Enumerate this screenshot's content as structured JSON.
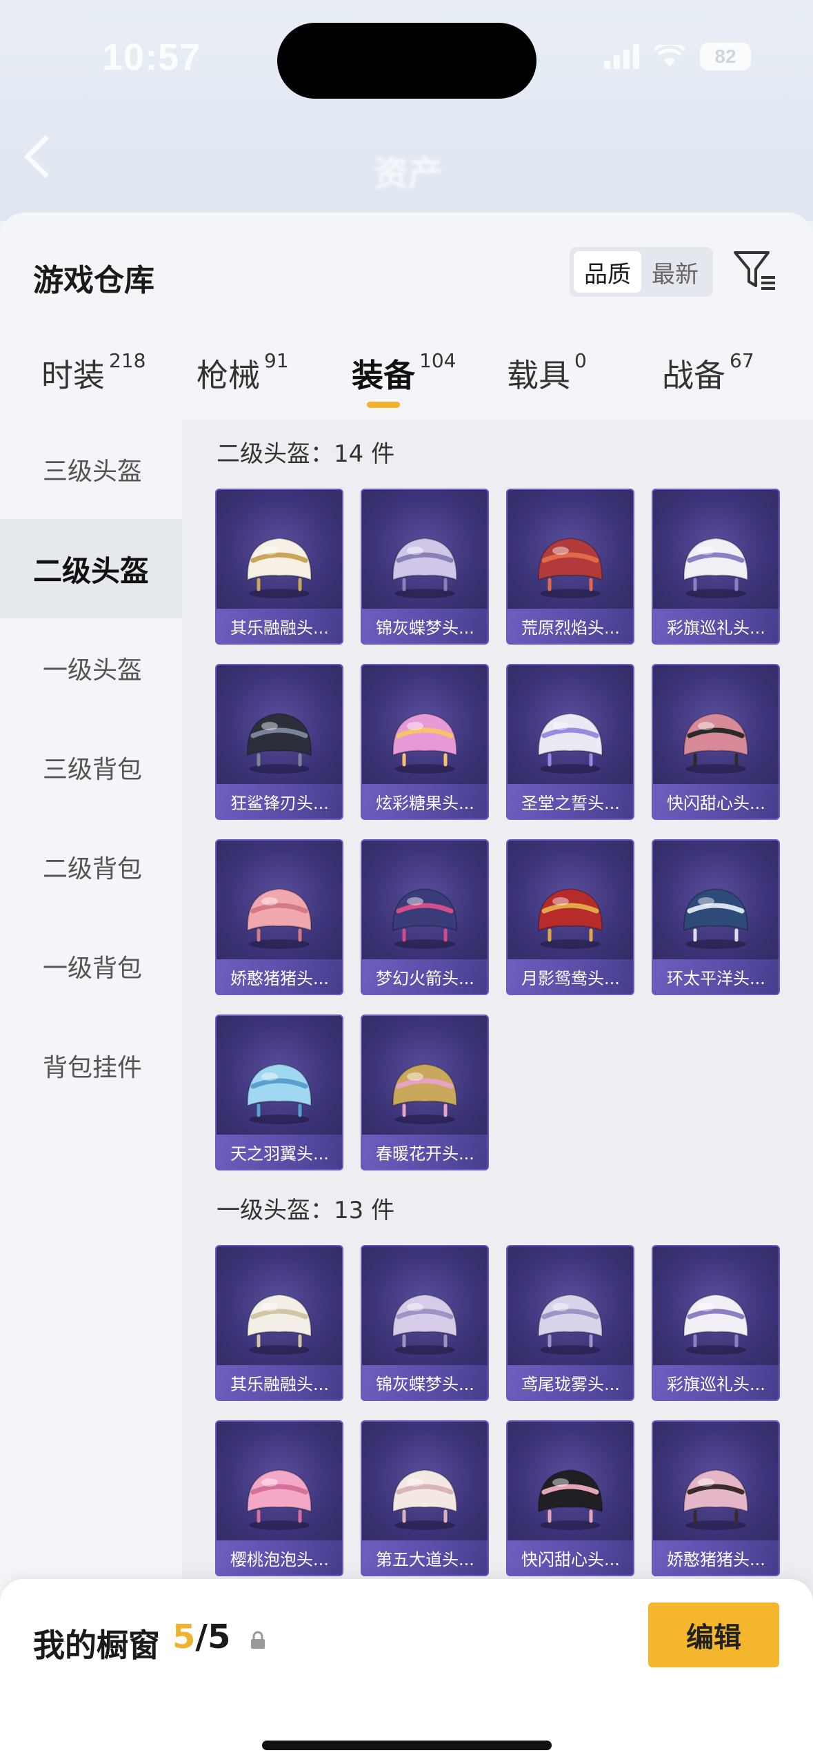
{
  "status": {
    "time": "10:57",
    "battery": "82"
  },
  "nav": {
    "title": "资产"
  },
  "sheet": {
    "title": "游戏仓库",
    "sort_options": [
      "品质",
      "最新"
    ],
    "active_sort": "品质"
  },
  "tabs": [
    {
      "label": "时装",
      "count": "218"
    },
    {
      "label": "枪械",
      "count": "91"
    },
    {
      "label": "装备",
      "count": "104"
    },
    {
      "label": "载具",
      "count": "0"
    },
    {
      "label": "战备",
      "count": "67"
    }
  ],
  "active_tab": "装备",
  "sidebar": {
    "items": [
      "三级头盔",
      "二级头盔",
      "一级头盔",
      "三级背包",
      "二级背包",
      "一级背包",
      "背包挂件"
    ],
    "active": "二级头盔"
  },
  "groups": [
    {
      "title": "二级头盔：14 件",
      "items": [
        "其乐融融头...",
        "锦灰蝶梦头...",
        "荒原烈焰头...",
        "彩旗巡礼头...",
        "狂鲨锋刃头...",
        "炫彩糖果头...",
        "圣堂之誓头...",
        "快闪甜心头...",
        "娇憨猪猪头...",
        "梦幻火箭头...",
        "月影鸳鸯头...",
        "环太平洋头...",
        "天之羽翼头...",
        "春暖花开头..."
      ]
    },
    {
      "title": "一级头盔：13 件",
      "items": [
        "其乐融融头...",
        "锦灰蝶梦头...",
        "鸢尾珑雾头...",
        "彩旗巡礼头...",
        "樱桃泡泡头...",
        "第五大道头...",
        "快闪甜心头...",
        "娇憨猪猪头..."
      ]
    }
  ],
  "bottom_bar": {
    "label": "我的橱窗",
    "used": "5",
    "total": "/5",
    "edit_label": "编辑"
  },
  "colors": {
    "accent": "#f4b62d",
    "card_bg": "#3c3478"
  }
}
